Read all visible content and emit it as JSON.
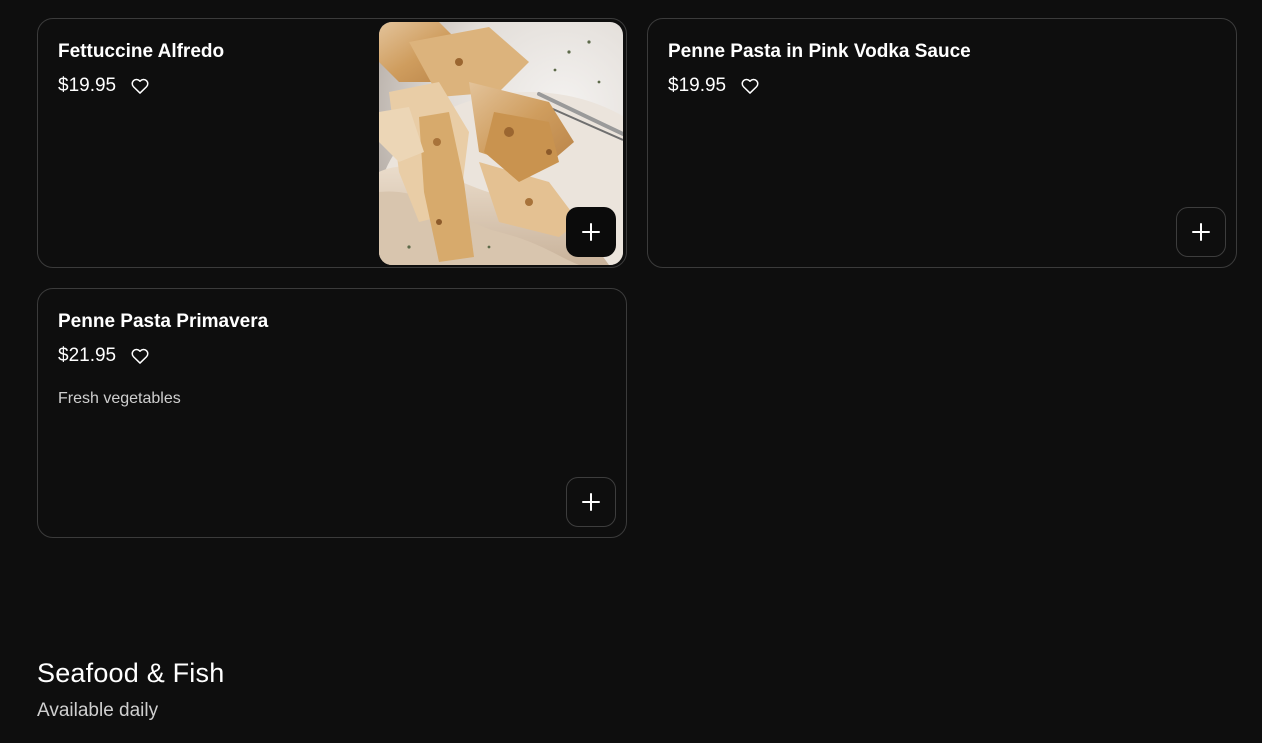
{
  "menu_items": [
    {
      "name": "Fettuccine Alfredo",
      "price": "$19.95",
      "description": "",
      "has_photo": true,
      "add_icon": "plus-icon",
      "favorite_icon": "heart-outline-icon"
    },
    {
      "name": "Penne Pasta in Pink Vodka Sauce",
      "price": "$19.95",
      "description": "",
      "has_photo": false,
      "add_icon": "plus-icon",
      "favorite_icon": "heart-outline-icon"
    },
    {
      "name": "Penne Pasta Primavera",
      "price": "$21.95",
      "description": "Fresh vegetables",
      "has_photo": false,
      "add_icon": "plus-icon",
      "favorite_icon": "heart-outline-icon"
    }
  ],
  "section": {
    "title": "Seafood & Fish",
    "subtitle": "Available daily"
  },
  "colors": {
    "background": "#0e0e0e",
    "card_border": "#3b3b3b",
    "text": "#ffffff",
    "muted_text": "#cfcfcf"
  }
}
